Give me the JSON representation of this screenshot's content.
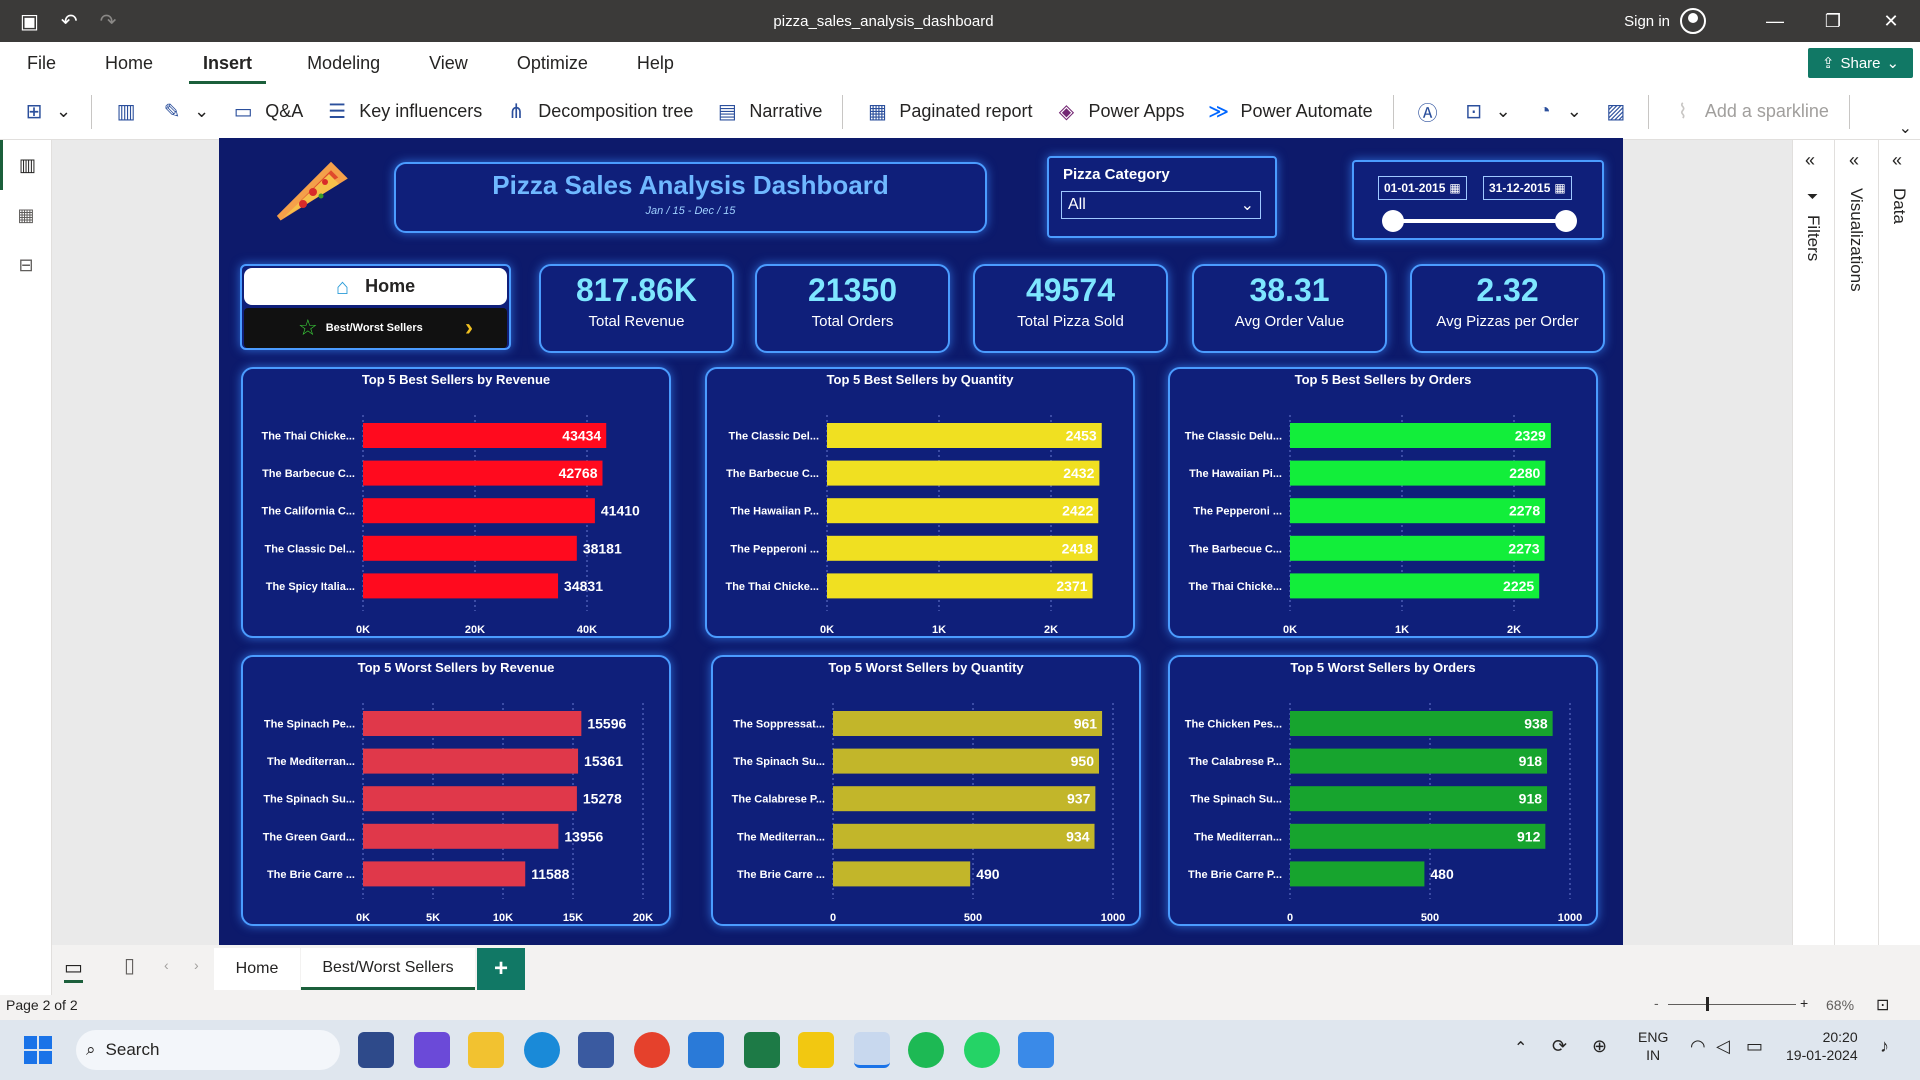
{
  "window": {
    "title": "pizza_sales_analysis_dashboard",
    "sign_in": "Sign in",
    "share": "Share"
  },
  "menu": [
    "File",
    "Home",
    "Insert",
    "Modeling",
    "View",
    "Optimize",
    "Help"
  ],
  "ribbon": {
    "qa": "Q&A",
    "key_influencers": "Key influencers",
    "decomposition_tree": "Decomposition tree",
    "narrative": "Narrative",
    "paginated_report": "Paginated report",
    "power_apps": "Power Apps",
    "power_automate": "Power Automate",
    "add_sparkline": "Add a sparkline"
  },
  "dashboard": {
    "title": "Pizza Sales Analysis Dashboard",
    "subtitle": "Jan / 15  -  Dec / 15",
    "category_label": "Pizza Category",
    "category_value": "All",
    "date_from": "01-01-2015",
    "date_to": "31-12-2015",
    "nav_home": "Home",
    "nav_bw": "Best/Worst Sellers",
    "kpis": [
      {
        "value": "817.86K",
        "label": "Total Revenue"
      },
      {
        "value": "21350",
        "label": "Total Orders"
      },
      {
        "value": "49574",
        "label": "Total Pizza Sold"
      },
      {
        "value": "38.31",
        "label": "Avg Order Value"
      },
      {
        "value": "2.32",
        "label": "Avg Pizzas per Order"
      }
    ]
  },
  "chart_data": [
    {
      "type": "bar",
      "title": "Top 5 Best Sellers by Revenue",
      "color": "#ff0a1e",
      "categories": [
        "The Thai Chicke...",
        "The Barbecue C...",
        "The California C...",
        "The Classic Del...",
        "The Spicy Italia..."
      ],
      "values": [
        43434,
        42768,
        41410,
        38181,
        34831
      ],
      "xlim": [
        0,
        50000
      ],
      "ticks": [
        "0K",
        "20K",
        "40K"
      ],
      "tickvals": [
        0,
        20000,
        40000
      ],
      "inside": [
        true,
        true,
        false,
        false,
        false
      ]
    },
    {
      "type": "bar",
      "title": "Top 5 Best Sellers by Quantity",
      "color": "#f0e021",
      "categories": [
        "The Classic Del...",
        "The Barbecue C...",
        "The Hawaiian P...",
        "The Pepperoni ...",
        "The Thai Chicke..."
      ],
      "values": [
        2453,
        2432,
        2422,
        2418,
        2371
      ],
      "xlim": [
        0,
        2500
      ],
      "ticks": [
        "0K",
        "1K",
        "2K"
      ],
      "tickvals": [
        0,
        1000,
        2000
      ],
      "inside": [
        true,
        true,
        true,
        true,
        true
      ]
    },
    {
      "type": "bar",
      "title": "Top 5 Best Sellers by Orders",
      "color": "#12ee3a",
      "categories": [
        "The Classic Delu...",
        "The Hawaiian Pi...",
        "The Pepperoni ...",
        "The Barbecue C...",
        "The Thai Chicke..."
      ],
      "values": [
        2329,
        2280,
        2278,
        2273,
        2225
      ],
      "xlim": [
        0,
        2500
      ],
      "ticks": [
        "0K",
        "1K",
        "2K"
      ],
      "tickvals": [
        0,
        1000,
        2000
      ],
      "inside": [
        true,
        true,
        true,
        true,
        true
      ]
    },
    {
      "type": "bar",
      "title": "Top 5 Worst Sellers by Revenue",
      "color": "#e0384a",
      "categories": [
        "The Spinach Pe...",
        "The Mediterran...",
        "The Spinach Su...",
        "The Green Gard...",
        "The Brie Carre ..."
      ],
      "values": [
        15596,
        15361,
        15278,
        13956,
        11588
      ],
      "xlim": [
        0,
        20000
      ],
      "ticks": [
        "0K",
        "5K",
        "10K",
        "15K",
        "20K"
      ],
      "tickvals": [
        0,
        5000,
        10000,
        15000,
        20000
      ],
      "inside": [
        false,
        false,
        false,
        false,
        false
      ]
    },
    {
      "type": "bar",
      "title": "Top 5 Worst Sellers by Quantity",
      "color": "#c2b62a",
      "categories": [
        "The Soppressat...",
        "The Spinach Su...",
        "The Calabrese P...",
        "The Mediterran...",
        "The Brie Carre ..."
      ],
      "values": [
        961,
        950,
        937,
        934,
        490
      ],
      "xlim": [
        0,
        1000
      ],
      "ticks": [
        "0",
        "500",
        "1000"
      ],
      "tickvals": [
        0,
        500,
        1000
      ],
      "inside": [
        true,
        true,
        true,
        true,
        false
      ]
    },
    {
      "type": "bar",
      "title": "Top 5 Worst Sellers by Orders",
      "color": "#17a42e",
      "categories": [
        "The Chicken Pes...",
        "The Calabrese P...",
        "The Spinach Su...",
        "The Mediterran...",
        "The Brie Carre P..."
      ],
      "values": [
        938,
        918,
        918,
        912,
        480
      ],
      "xlim": [
        0,
        1000
      ],
      "ticks": [
        "0",
        "500",
        "1000"
      ],
      "tickvals": [
        0,
        500,
        1000
      ],
      "inside": [
        true,
        true,
        true,
        true,
        false
      ]
    }
  ],
  "pages": {
    "tab1": "Home",
    "tab2": "Best/Worst Sellers",
    "status": "Page 2 of 2",
    "zoom": "68%"
  },
  "panes": {
    "filters": "Filters",
    "visualizations": "Visualizations",
    "data": "Data"
  },
  "taskbar": {
    "search": "Search",
    "lang1": "ENG",
    "lang2": "IN",
    "time": "20:20",
    "date": "19-01-2024"
  }
}
